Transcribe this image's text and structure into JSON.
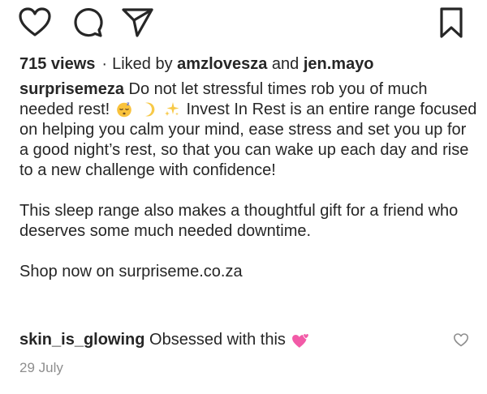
{
  "actions": {
    "like_icon": "heart-icon",
    "comment_icon": "comment-bubble-icon",
    "share_icon": "paper-plane-icon",
    "save_icon": "bookmark-icon"
  },
  "post": {
    "views": "715 views",
    "separator": "·",
    "liked_by_prefix": "Liked by",
    "liked_by_user1": "amzlovesza",
    "liked_by_and": "and",
    "liked_by_user2": "jen.mayo",
    "caption_username": "surprisemeza",
    "caption_part1": "Do not let stressful times rob you of much needed rest!",
    "caption_emojis": [
      "sleeping-face-emoji",
      "crescent-moon-emoji",
      "sparkles-emoji"
    ],
    "caption_part2": "Invest In Rest is an entire range focused on helping you calm your mind, ease stress and set you up for a good night’s rest, so that you can wake up each day and rise to a new challenge with confidence!",
    "caption_paragraph2": "This sleep range also makes a thoughtful gift for a friend who deserves some much needed downtime.",
    "caption_paragraph3": "Shop now on surpriseme.co.za"
  },
  "comment": {
    "username": "skin_is_glowing",
    "text": "Obsessed with this",
    "emoji": "two-hearts-emoji",
    "like_icon": "small-heart-icon"
  },
  "date": "29 July",
  "colors": {
    "text": "#262626",
    "secondary_text": "#8e8e8e",
    "background": "#ffffff"
  }
}
